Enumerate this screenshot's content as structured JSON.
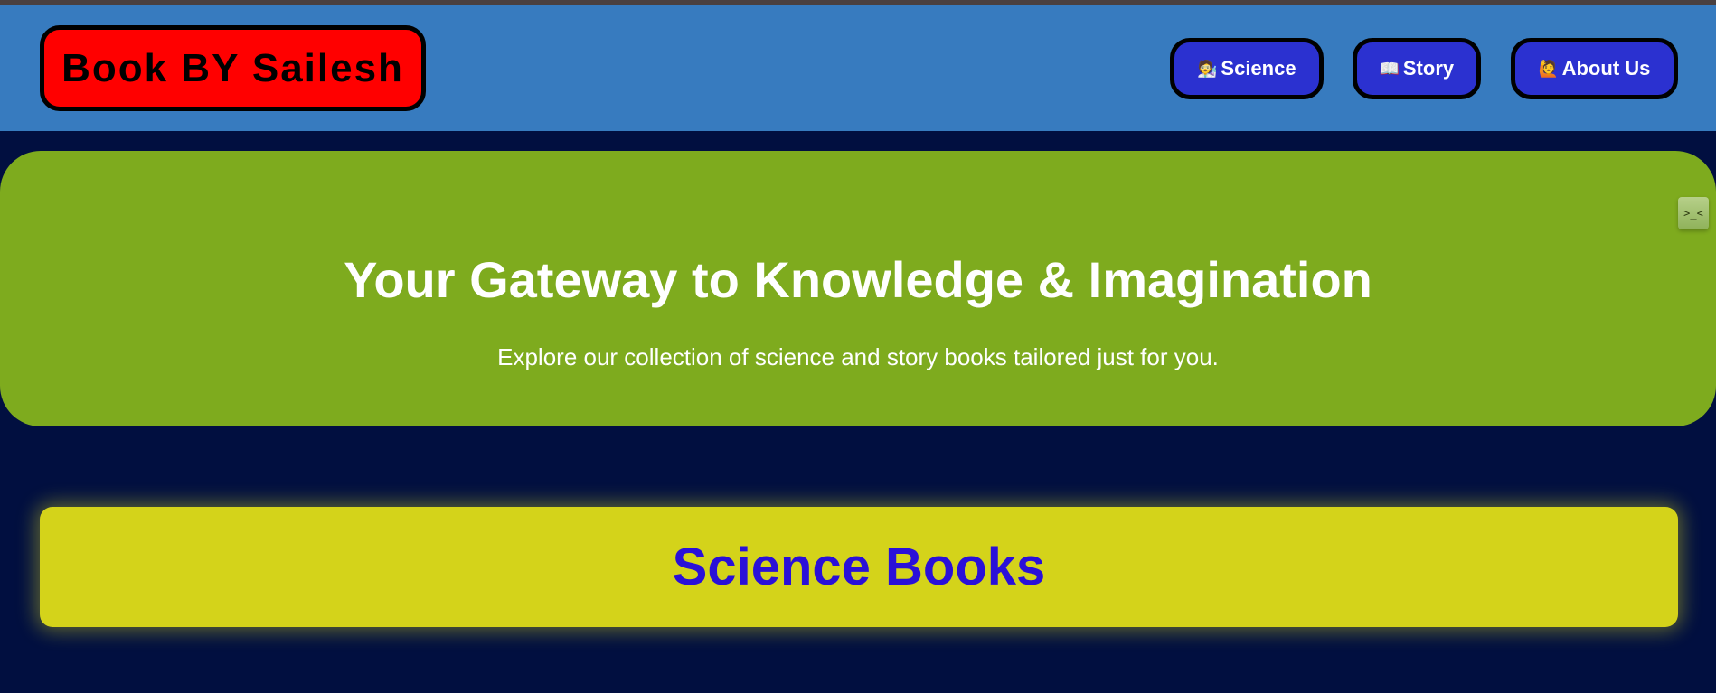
{
  "header": {
    "brand": "Book BY Sailesh",
    "nav": [
      {
        "label": "Science",
        "icon": "🧑‍🔬",
        "icon_name": "scientist-icon"
      },
      {
        "label": "Story",
        "icon": "📖",
        "icon_name": "open-book-icon"
      },
      {
        "label": "About Us",
        "icon": "🙋",
        "icon_name": "person-raising-hand-icon"
      }
    ]
  },
  "hero": {
    "title": "Your Gateway to Knowledge & Imagination",
    "subtitle": "Explore our collection of science and story books tailored just for you."
  },
  "extension_widget": {
    "glyph": ">_<",
    "icon_name": "extension-face-icon"
  },
  "section": {
    "title": "Science Books"
  },
  "colors": {
    "page_background": "#010f40",
    "header_background": "#377bbf",
    "brand_background": "#ff0000",
    "nav_button_background": "#2b31d0",
    "hero_background": "#7eab1e",
    "section_background": "#d4d31a",
    "section_text": "#2a10d8"
  }
}
